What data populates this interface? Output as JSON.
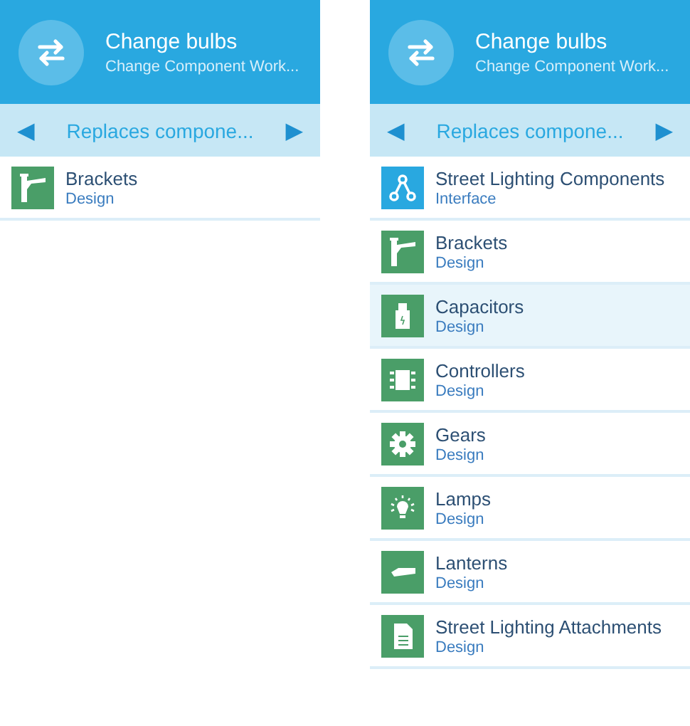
{
  "panels": [
    {
      "header": {
        "title": "Change bulbs",
        "subtitle": "Change Component Work..."
      },
      "nav": {
        "prev": "◀",
        "label": "Replaces compone...",
        "next": "▶"
      },
      "items": [
        {
          "name": "Brackets",
          "type": "Design",
          "kind": "bracket",
          "color": "#4a9e68",
          "selected": false
        }
      ]
    },
    {
      "header": {
        "title": "Change bulbs",
        "subtitle": "Change Component Work..."
      },
      "nav": {
        "prev": "◀",
        "label": "Replaces compone...",
        "next": "▶"
      },
      "items": [
        {
          "name": "Street Lighting Components",
          "type": "Interface",
          "kind": "network",
          "color": "#29a8e0",
          "selected": false
        },
        {
          "name": "Brackets",
          "type": "Design",
          "kind": "bracket",
          "color": "#4a9e68",
          "selected": false
        },
        {
          "name": "Capacitors",
          "type": "Design",
          "kind": "capacitor",
          "color": "#4a9e68",
          "selected": true
        },
        {
          "name": "Controllers",
          "type": "Design",
          "kind": "chip",
          "color": "#4a9e68",
          "selected": false
        },
        {
          "name": "Gears",
          "type": "Design",
          "kind": "gear",
          "color": "#4a9e68",
          "selected": false
        },
        {
          "name": "Lamps",
          "type": "Design",
          "kind": "bulb",
          "color": "#4a9e68",
          "selected": false
        },
        {
          "name": "Lanterns",
          "type": "Design",
          "kind": "lantern",
          "color": "#4a9e68",
          "selected": false
        },
        {
          "name": "Street Lighting Attachments",
          "type": "Design",
          "kind": "document",
          "color": "#4a9e68",
          "selected": false
        }
      ]
    }
  ]
}
